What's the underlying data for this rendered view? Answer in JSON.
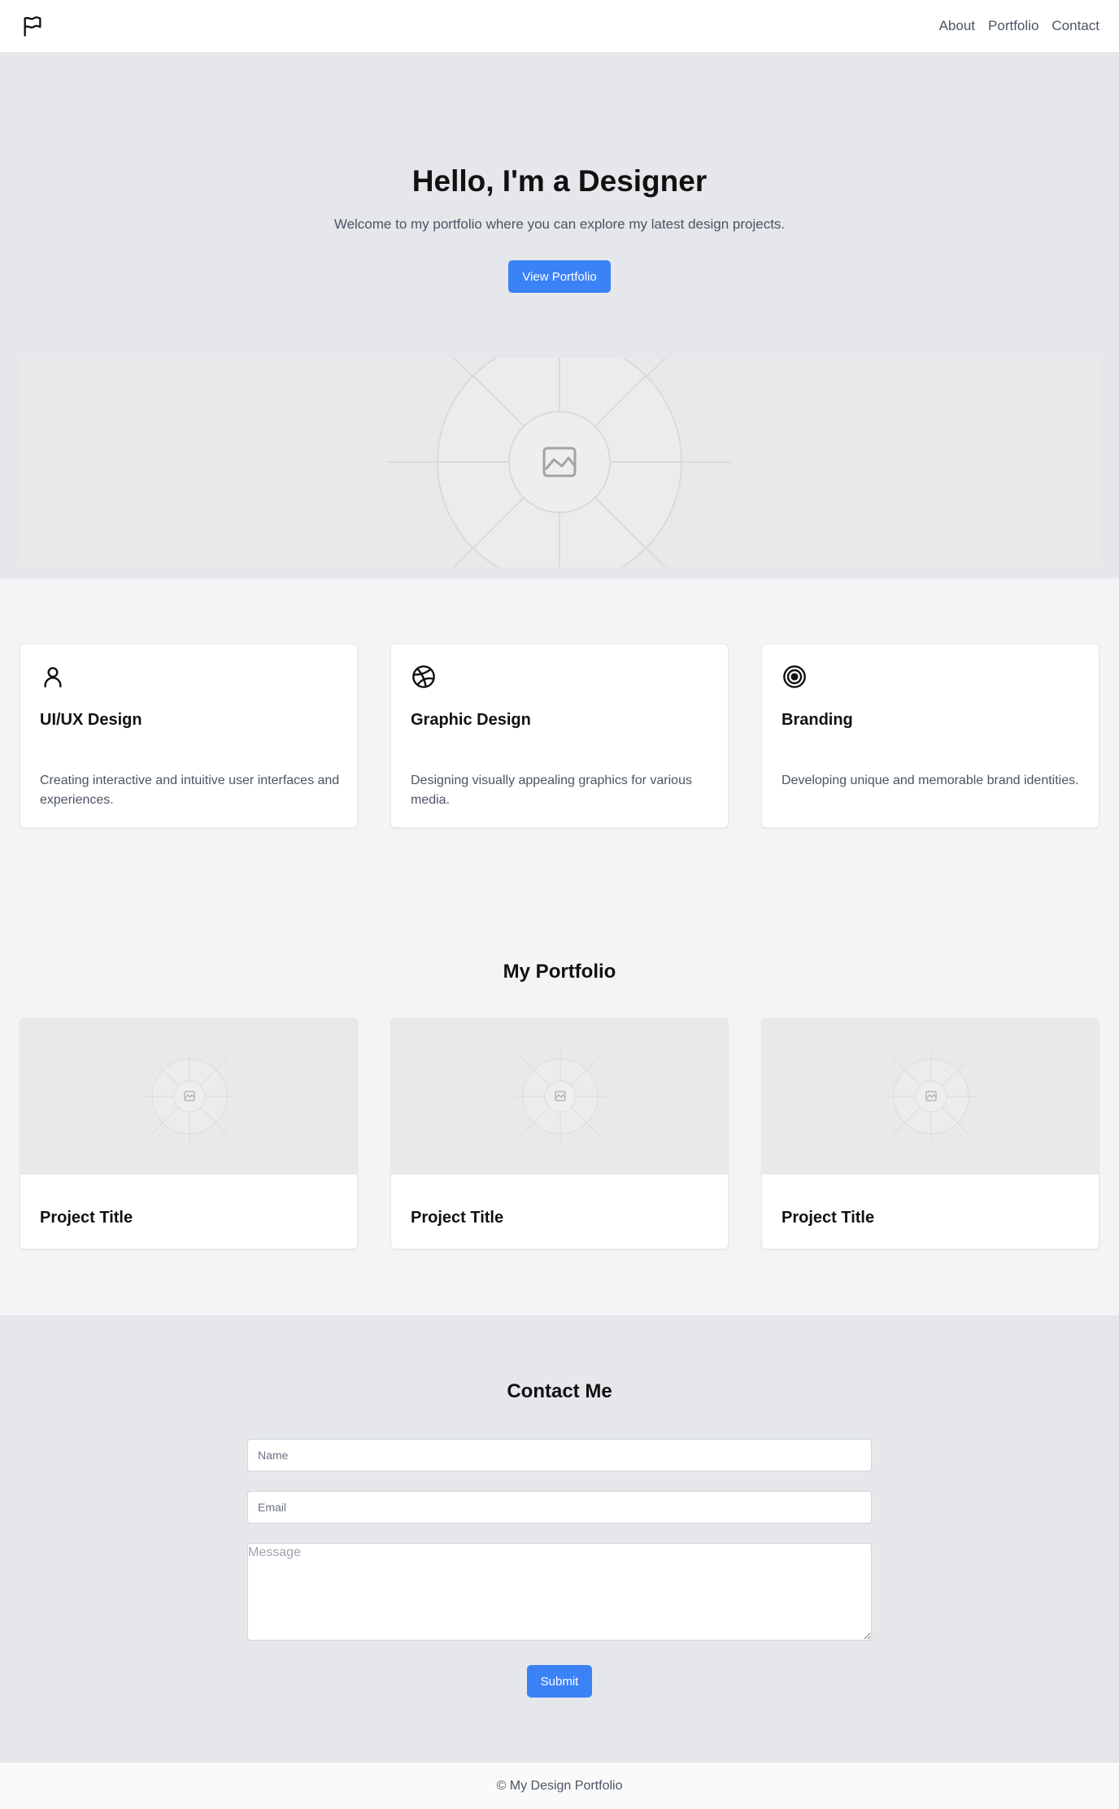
{
  "header": {
    "logo_icon": "flag-icon",
    "nav": [
      {
        "label": "About"
      },
      {
        "label": "Portfolio"
      },
      {
        "label": "Contact"
      }
    ]
  },
  "hero": {
    "title": "Hello, I'm a Designer",
    "subtitle": "Welcome to my portfolio where you can explore my latest design projects.",
    "button_label": "View Portfolio",
    "image_icon": "image-placeholder-icon"
  },
  "services": [
    {
      "icon": "user-icon",
      "title": "UI/UX Design",
      "description": "Creating interactive and intuitive user interfaces and experiences."
    },
    {
      "icon": "dribbble-icon",
      "title": "Graphic Design",
      "description": "Designing visually appealing graphics for various media."
    },
    {
      "icon": "target-icon",
      "title": "Branding",
      "description": "Developing unique and memorable brand identities."
    }
  ],
  "portfolio": {
    "heading": "My Portfolio",
    "projects": [
      {
        "title": "Project Title"
      },
      {
        "title": "Project Title"
      },
      {
        "title": "Project Title"
      }
    ]
  },
  "contact": {
    "heading": "Contact Me",
    "name_placeholder": "Name",
    "email_placeholder": "Email",
    "message_placeholder": "Message",
    "submit_label": "Submit"
  },
  "footer": {
    "text": "© My Design Portfolio"
  },
  "colors": {
    "accent": "#3b82f6",
    "hero_bg": "#e5e7eb",
    "page_bg": "#f3f4f6"
  }
}
